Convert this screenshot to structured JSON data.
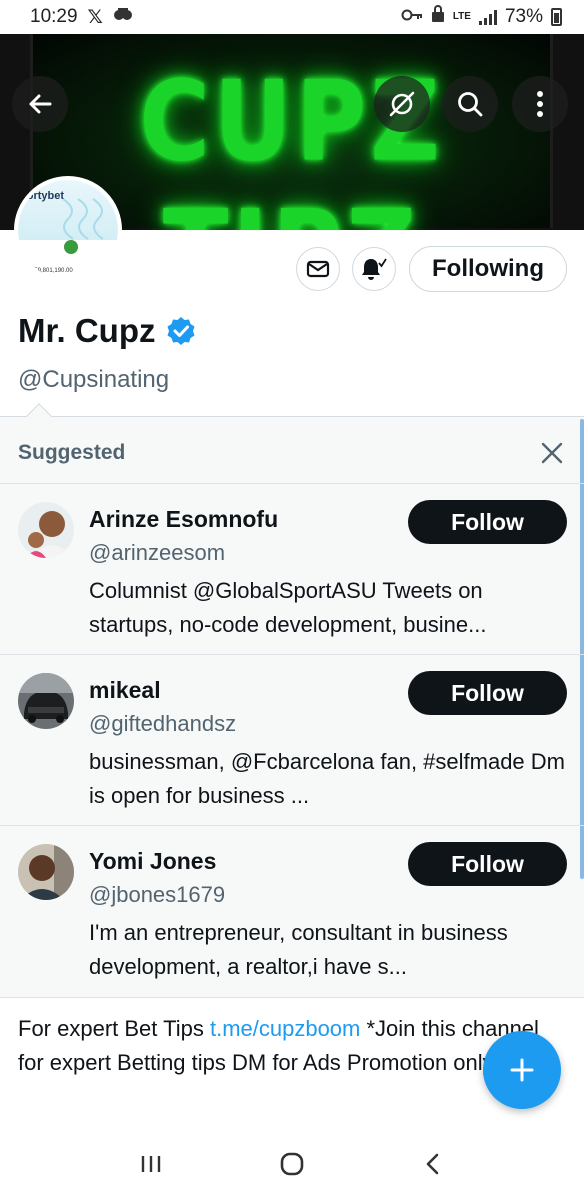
{
  "status_bar": {
    "time": "10:29",
    "network": "LTE",
    "battery": "73%"
  },
  "banner": {
    "text": "CUPZ TIPZ"
  },
  "avatar": {
    "logo_text": "portybet",
    "amount_text": "₦59,801,190.00"
  },
  "profile": {
    "name": "Mr. Cupz",
    "handle": "@Cupsinating",
    "following_label": "Following",
    "verified": true
  },
  "suggested": {
    "title": "Suggested",
    "items": [
      {
        "name": "Arinze Esomnofu",
        "handle": "@arinzeesom",
        "bio": "Columnist @GlobalSportASU  Tweets on startups, no-code development, busine...",
        "follow_label": "Follow"
      },
      {
        "name": "mikeal",
        "handle": "@giftedhandsz",
        "bio": "businessman, @Fcbarcelona  fan, #selfmade Dm is open for business ...",
        "follow_label": "Follow"
      },
      {
        "name": "Yomi Jones",
        "handle": "@jbones1679",
        "bio": "I'm an entrepreneur, consultant in business development, a realtor,i have s...",
        "follow_label": "Follow"
      }
    ]
  },
  "bio": {
    "prefix": "For expert Bet Tips  ",
    "link": "t.me/cupzboom",
    "suffix": "  *Join this channel for expert Betting tips DM for Ads Promotion only."
  },
  "colors": {
    "accent": "#1d9bf0",
    "follow_bg": "#0f1419",
    "banner_glow": "#1bd42a"
  },
  "icons": [
    "back-arrow-icon",
    "mute-icon",
    "search-icon",
    "more-icon",
    "mail-icon",
    "bell-icon",
    "verified-icon",
    "close-icon",
    "compose-plus-icon",
    "recents-icon",
    "home-icon",
    "back-nav-icon"
  ]
}
